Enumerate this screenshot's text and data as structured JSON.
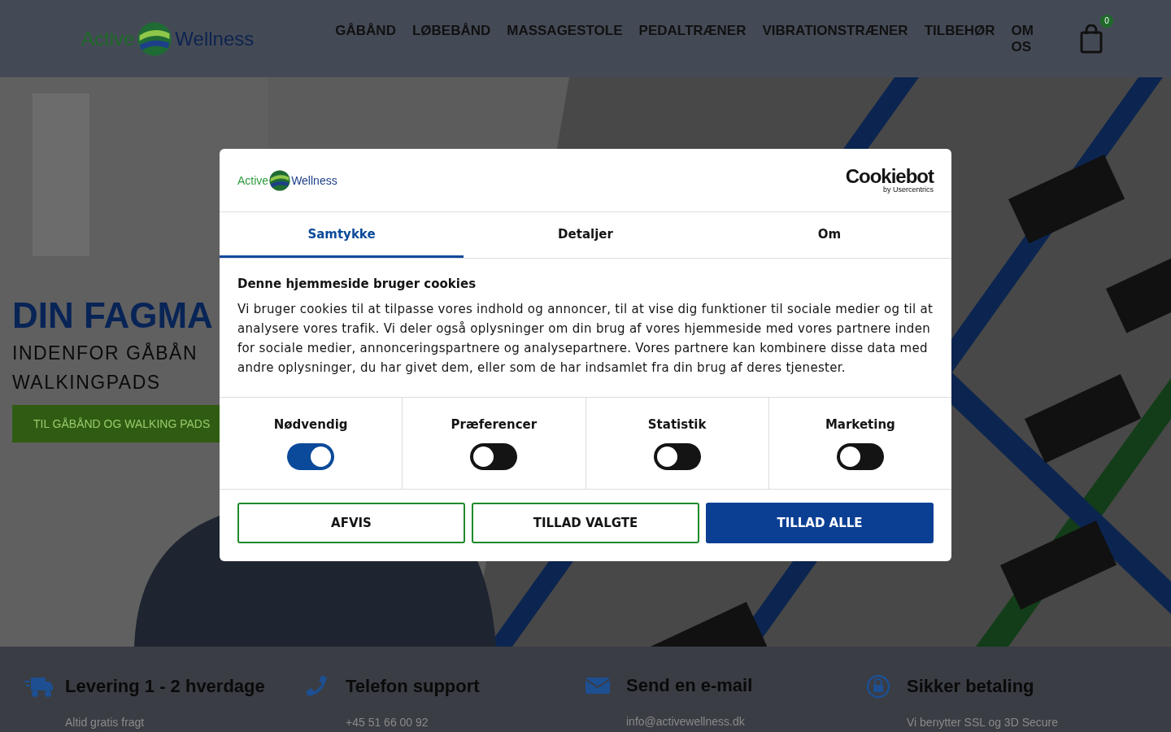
{
  "header": {
    "logo": {
      "word_1": "Active",
      "word_2": "Wellness"
    },
    "nav": [
      "GÅBÅND",
      "LØBEBÅND",
      "MASSAGESTOLE",
      "PEDALTRÆNER",
      "VIBRATIONSTRÆNER",
      "TILBEHØR",
      "OM OS"
    ],
    "cart_count": "0"
  },
  "hero": {
    "title": "DIN FAGMA",
    "subtitle_line_1": "INDENFOR GÅBÅN",
    "subtitle_line_2": "WALKINGPADS",
    "button": "TIL GÅBÅND OG WALKING PADS"
  },
  "features": [
    {
      "kind": "truck",
      "title": "Levering 1 - 2 hverdage",
      "text": "Altid gratis fragt"
    },
    {
      "kind": "phone",
      "title": "Telefon support",
      "text": "+45 51 66 00 92"
    },
    {
      "kind": "mail",
      "title": "Send en e-mail",
      "text": "info@activewellness.dk"
    },
    {
      "kind": "lock",
      "title": "Sikker betaling",
      "text": "Vi benytter SSL og 3D Secure"
    }
  ],
  "cookie_dialog": {
    "logo": {
      "word_1": "Active",
      "word_2": "Wellness"
    },
    "provider": {
      "name": "Cookiebot",
      "byline": "by Usercentrics"
    },
    "tabs": [
      {
        "label": "Samtykke",
        "selected": true
      },
      {
        "label": "Detaljer",
        "selected": false
      },
      {
        "label": "Om",
        "selected": false
      }
    ],
    "heading": "Denne hjemmeside bruger cookies",
    "text": "Vi bruger cookies til at tilpasse vores indhold og annoncer, til at vise dig funktioner til sociale medier og til at analysere vores trafik. Vi deler også oplysninger om din brug af vores hjemmeside med vores partnere inden for sociale medier, annonceringspartnere og analysepartnere. Vores partnere kan kombinere disse data med andre oplysninger, du har givet dem, eller som de har indsamlet fra din brug af deres tjenester.",
    "categories": [
      {
        "label": "Nødvendig",
        "checked": true
      },
      {
        "label": "Præferencer",
        "checked": false
      },
      {
        "label": "Statistik",
        "checked": false
      },
      {
        "label": "Marketing",
        "checked": false
      }
    ],
    "buttons": [
      {
        "label": "AFVIS",
        "kind": "outline"
      },
      {
        "label": "TILLAD VALGTE",
        "kind": "outline"
      },
      {
        "label": "TILLAD ALLE",
        "kind": "primary"
      }
    ]
  }
}
